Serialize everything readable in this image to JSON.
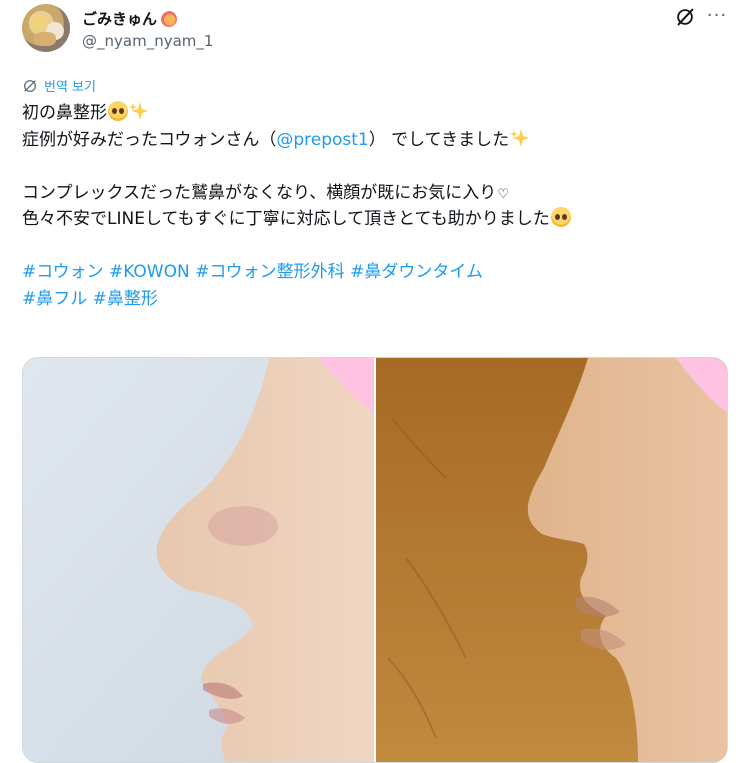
{
  "user": {
    "display_name": "ごみきゅん",
    "handle": "@_nyam_nyam_1"
  },
  "header": {
    "grok_icon": "grok-icon",
    "more_icon": "more-icon",
    "more_label": "···"
  },
  "translate": {
    "label": "번역 보기",
    "icon": "globe-icon"
  },
  "tweet": {
    "line1_text": "初の鼻整形",
    "line2_before": "症例が好みだったコウォンさん（",
    "line2_mention": "@prepost1",
    "line2_after": "） でしてきました",
    "line3_text": "コンプレックスだった鷲鼻がなくなり、横顔が既にお気に入り",
    "line3_heart": "♡",
    "line4_text": "色々不安でLINEしてもすぐに丁寧に対応して頂きとても助かりました",
    "hashtags_line1": "#コウォン #KOWON #コウォン整形外科 #鼻ダウンタイム",
    "hashtags_line2": "#鼻フル #鼻整形"
  },
  "media": {
    "left_image": "profile-photo-before",
    "right_image": "profile-photo-after"
  },
  "colors": {
    "text": "#0f1419",
    "secondary": "#536471",
    "accent": "#1d9bf0",
    "border": "#cfd9de"
  }
}
